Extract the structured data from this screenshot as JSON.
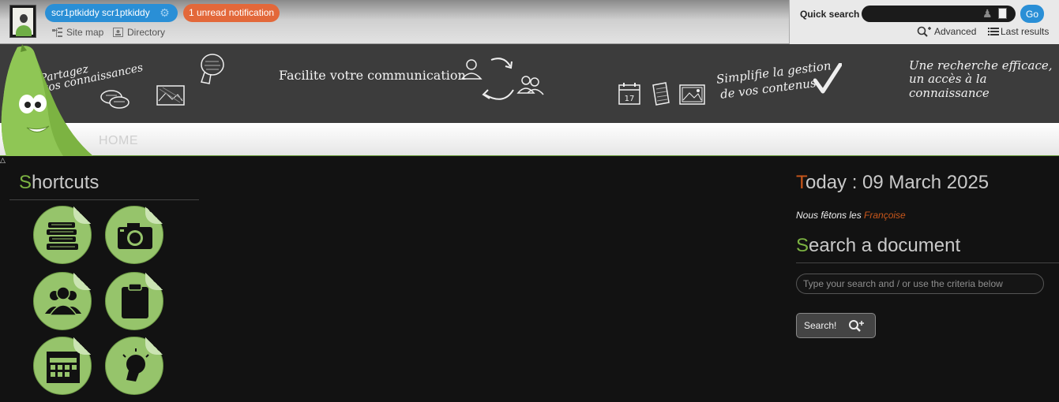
{
  "topbar": {
    "user_name": "scr1ptkiddy scr1ptkiddy",
    "notification": "1 unread notification",
    "site_map": "Site map",
    "directory": "Directory"
  },
  "quick_search": {
    "label": "Quick search",
    "value": "",
    "go": "Go",
    "advanced": "Advanced",
    "last_results": "Last results"
  },
  "banner": {
    "tagline_1_line_1": "Partagez",
    "tagline_1_line_2": "vos connaissances",
    "tagline_2": "Facilite votre communication",
    "tagline_3_line_1": "Simplifie la gestion",
    "tagline_3_line_2": "de vos contenus",
    "tagline_4_line_1": "Une recherche efficace,",
    "tagline_4_line_2": "un accès à la connaissance",
    "calendar_day": "17"
  },
  "nav": {
    "home": "HOME"
  },
  "shortcuts": {
    "title_first": "S",
    "title_rest": "hortcuts",
    "items": [
      {
        "icon": "books-icon"
      },
      {
        "icon": "camera-icon"
      },
      {
        "icon": "users-icon"
      },
      {
        "icon": "clipboard-icon"
      },
      {
        "icon": "calendar-icon"
      },
      {
        "icon": "lightbulb-icon"
      }
    ]
  },
  "today": {
    "title_first": "T",
    "title_rest": "oday : 09 March 2025",
    "fete_prefix": "Nous fêtons les ",
    "fete_name": "Françoise"
  },
  "doc_search": {
    "title_first": "S",
    "title_rest": "earch a document",
    "placeholder": "Type your search and / or use the criteria below",
    "button": "Search!"
  },
  "colors": {
    "accent_green": "#7cb342",
    "accent_orange": "#c9571b",
    "blue_pill": "#2a8fd6",
    "orange_pill": "#e3683a",
    "shortcut_green": "#96c46b"
  }
}
